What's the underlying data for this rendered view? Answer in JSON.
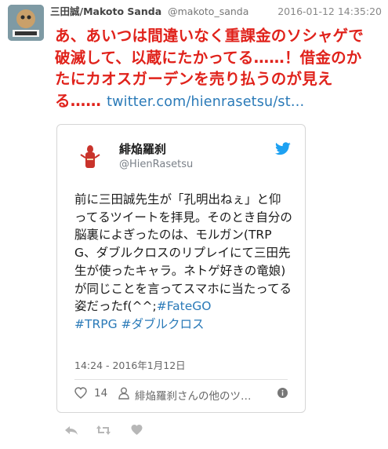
{
  "tweet": {
    "author_name": "三田誠/Makoto Sanda",
    "author_handle": "@makoto_sanda",
    "timestamp": "2016-01-12 14:35:20",
    "text": "あ、あいつは間違いなく重課金のソシャゲで破滅して、以蔵にたかってる……！借金のかたにカオスガーデンを売り払うのが見える…… ",
    "link": "twitter.com/hienrasetsu/st…"
  },
  "quoted": {
    "name": "緋焔羅刹",
    "handle": "@HienRasetsu",
    "text": "前に三田誠先生が「孔明出ねぇ」と仰ってるツイートを拝見。そのとき自分の脳裏によぎったのは、モルガン(TRPG、ダブルクロスのリプレイにて三田先生が使ったキャラ。ネトゲ好きの竜娘)が同じことを言ってスマホに当たってる姿だったf(^^;",
    "hashtag_1": "#FateGO",
    "hashtag_2": "#TRPG",
    "hashtag_3": "#ダブルクロス",
    "time": "14:24 - 2016年1月12日",
    "likes": "14",
    "more_text": "緋焔羅刹さんの他のツ…"
  },
  "icons": {
    "avatar": "avatar-image",
    "bird": "twitter-bird-icon",
    "heart": "heart-icon",
    "person": "person-icon",
    "info": "info-icon",
    "reply": "reply-icon",
    "retweet": "retweet-icon",
    "like": "heart-icon"
  },
  "colors": {
    "accent_red": "#e0221b",
    "link_blue": "#2a7ab8",
    "twitter_blue": "#1da1f2"
  }
}
